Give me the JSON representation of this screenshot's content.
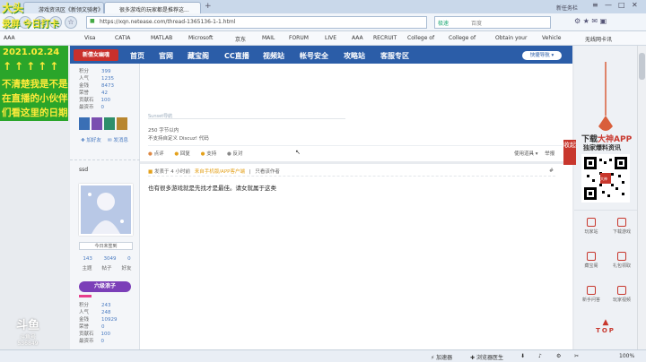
{
  "browser": {
    "tabs": [
      {
        "label": "游戏资讯区《新领文骑者》"
      },
      {
        "label": "很多游戏的玩家都是推荐这..."
      }
    ],
    "window_buttons": [
      "新任务栏",
      "≡",
      "—",
      "□",
      "✕"
    ],
    "url": "https://xqn.netease.com/thread-1365136-1-1.html",
    "search_engine": "极速",
    "search_placeholder": "百度",
    "bookmarks": [
      "AAA",
      "Visa",
      "CATIA",
      "MATLAB",
      "Microsoft",
      "京东",
      "MAIL",
      "FORUM",
      "LIVE",
      "AAA",
      "RECRUIT",
      "College of",
      "College of",
      "Obtain your",
      "Vehicle",
      "无线网卡讯"
    ]
  },
  "site": {
    "logo": "新倩女幽魂",
    "nav": [
      "首页",
      "官网",
      "藏宝阁",
      "CC直播",
      "视频站",
      "帐号安全",
      "攻略站",
      "客服专区"
    ],
    "nav_right": "快捷导航"
  },
  "overlay": {
    "line1": "大头",
    "line2": "录屏 今日打卡",
    "line3": "2021.02.24",
    "arrows": "↑↑↑↑↑",
    "line4": "不清楚我是不是",
    "line5": "在直播的小伙伴",
    "line6": "们看这里的日期",
    "platform": "斗鱼",
    "platform_sub": "斗鱼号",
    "room_id": "536849"
  },
  "post1": {
    "stats": [
      [
        "积分",
        "399"
      ],
      [
        "人气",
        "1235"
      ],
      [
        "金钱",
        "8473"
      ],
      [
        "荣誉",
        "42"
      ],
      [
        "贡献石",
        "100"
      ],
      [
        "最资币",
        "0"
      ]
    ],
    "buttons": [
      "加好友",
      "发消息"
    ],
    "signature": "Sunset导航",
    "text1": "250 字节以内",
    "text2": "不支持自定义 Discuz! 代码",
    "actions": [
      "点评",
      "回复",
      "支持",
      "反对"
    ],
    "actions_right": [
      "使用道具",
      "举报"
    ]
  },
  "post2": {
    "username": "ssd",
    "signin": "今日未签到",
    "counts": [
      [
        "143",
        "主题"
      ],
      [
        "3049",
        "帖子"
      ],
      [
        "0",
        "好友"
      ]
    ],
    "badge": "六级浪子",
    "meta_prefix": "发表于 4 小时前",
    "meta_device": "来自手机版/APP客户端",
    "meta_only": "只看该作者",
    "floor": "#",
    "body": "也有很多游戏就是先找才是最佳。请女就属于这类",
    "stats": [
      [
        "积分",
        "243"
      ],
      [
        "人气",
        "248"
      ],
      [
        "金钱",
        "10929"
      ],
      [
        "荣誉",
        "0"
      ],
      [
        "贡献石",
        "100"
      ],
      [
        "最资币",
        "0"
      ]
    ]
  },
  "rightpanel": {
    "collapse": "收起",
    "title_pre": "下载",
    "title_brand": "大神APP",
    "subtitle": "独家爆料资讯",
    "qr_center": "大神",
    "tools": [
      "玩家站",
      "下载游戏",
      "藏宝阁",
      "礼包领取",
      "新手问答",
      "玩家视频"
    ],
    "top": "TOP"
  },
  "status": {
    "items": [
      "加速器",
      "浏览器医生",
      "",
      ""
    ],
    "zoom": "100%"
  }
}
